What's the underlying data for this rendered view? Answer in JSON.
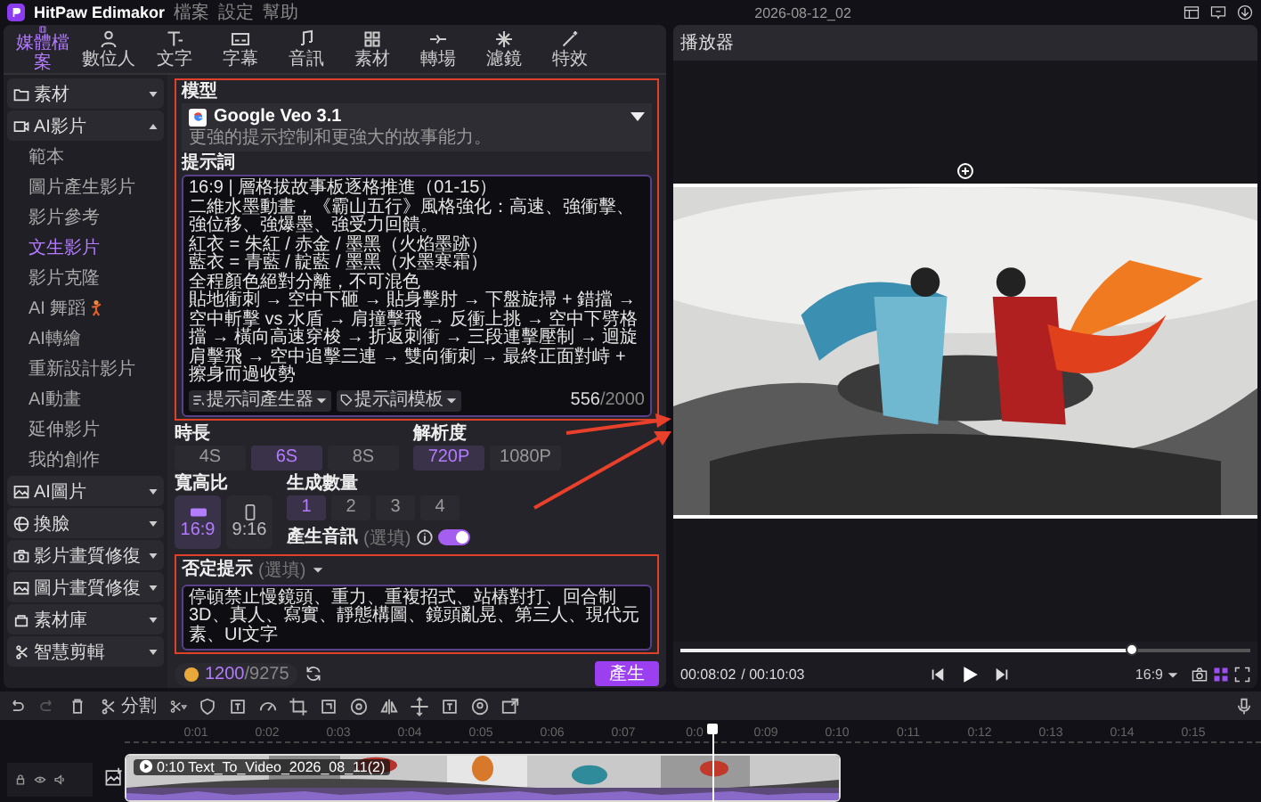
{
  "app": {
    "name": "HitPaw Edimakor",
    "menu": [
      "檔案",
      "設定",
      "幫助"
    ],
    "project": "2026-08-12_02"
  },
  "tabs": [
    {
      "label": "媒體檔案",
      "selected": true
    },
    {
      "label": "數位人",
      "selected": false
    },
    {
      "label": "文字",
      "selected": false
    },
    {
      "label": "字幕",
      "selected": false
    },
    {
      "label": "音訊",
      "selected": false
    },
    {
      "label": "素材",
      "selected": false
    },
    {
      "label": "轉場",
      "selected": false
    },
    {
      "label": "濾鏡",
      "selected": false
    },
    {
      "label": "特效",
      "selected": false
    }
  ],
  "sidebar": {
    "items": [
      {
        "label": "素材",
        "expanded": false
      },
      {
        "label": "AI影片",
        "expanded": true,
        "children": [
          {
            "label": "範本",
            "selected": false
          },
          {
            "label": "圖片產生影片",
            "selected": false
          },
          {
            "label": "影片參考",
            "selected": false
          },
          {
            "label": "文生影片",
            "selected": true
          },
          {
            "label": "影片克隆",
            "selected": false
          },
          {
            "label": "AI 舞蹈",
            "selected": false,
            "kind": "badge"
          },
          {
            "label": "AI轉繪",
            "selected": false
          },
          {
            "label": "重新設計影片",
            "selected": false
          },
          {
            "label": "AI動畫",
            "selected": false
          },
          {
            "label": "延伸影片",
            "selected": false
          },
          {
            "label": "我的創作",
            "selected": false
          }
        ]
      },
      {
        "label": "AI圖片",
        "expanded": false
      },
      {
        "label": "換臉",
        "expanded": false
      },
      {
        "label": "影片畫質修復",
        "expanded": false
      },
      {
        "label": "圖片畫質修復",
        "expanded": false
      },
      {
        "label": "素材庫",
        "expanded": false
      },
      {
        "label": "智慧剪輯",
        "expanded": false
      }
    ]
  },
  "panel": {
    "model": {
      "label": "模型",
      "name": "Google Veo 3.1",
      "description": "更強的提示控制和更強大的故事能力。"
    },
    "prompt": {
      "label": "提示詞",
      "value": [
        "16:9 | 層格拔故事板逐格推進（01-15）",
        "二維水墨動畫，《霸山五行》風格強化：高速、強衝擊、強位移、強爆墨、強受力回饋。",
        "紅衣 = 朱紅 / 赤金 / 墨黑（火焰墨跡）",
        "藍衣 = 青藍 / 靛藍 / 墨黑（水墨寒霜）",
        "全程顏色絕對分離，不可混色",
        "貼地衝刺 → 空中下砸 → 貼身擊肘 → 下盤旋掃 + 錯擋 → 空中斬擊 vs 水盾 → 肩撞擊飛 → 反衝上挑 → 空中下劈格擋 → 橫向高速穿梭 → 折返刺衝 → 三段連擊壓制 → 迴旋肩擊飛 → 空中追擊三連 → 雙向衝刺 → 最終正面對峙 + 擦身而過收勢"
      ],
      "buttons": [
        "提示詞產生器",
        "提示詞模板"
      ],
      "count": "556",
      "limit": "/2000"
    },
    "duration": {
      "label": "時長",
      "options": [
        {
          "label": "4S",
          "selected": false
        },
        {
          "label": "6S",
          "selected": true
        },
        {
          "label": "8S",
          "selected": false
        }
      ]
    },
    "resolution": {
      "label": "解析度",
      "options": [
        {
          "label": "720P",
          "selected": true
        },
        {
          "label": "1080P",
          "selected": false
        }
      ]
    },
    "aspect": {
      "label": "寬高比",
      "options": [
        {
          "label": "16:9",
          "selected": true,
          "kind": "landscape"
        },
        {
          "label": "9:16",
          "selected": false,
          "kind": "portrait"
        }
      ]
    },
    "count": {
      "label": "生成數量",
      "options": [
        {
          "label": "1",
          "selected": true
        },
        {
          "label": "2",
          "selected": false
        },
        {
          "label": "3",
          "selected": false
        },
        {
          "label": "4",
          "selected": false
        }
      ]
    },
    "audio": {
      "label": "產生音訊",
      "hint": "(選填)",
      "on": true
    },
    "negative": {
      "label": "否定提示",
      "hint": "(選填)",
      "value": [
        "停頓禁止慢鏡頭、重力、重複招式、站樁對打、回合制",
        "3D、真人、寫實、靜態構圖、鏡頭亂晃、第三人、現代元素、UI文字"
      ]
    },
    "credits": {
      "used": "1200",
      "total": "/9275"
    },
    "generate": "產生"
  },
  "player": {
    "title": "播放器",
    "current": "00:08:02",
    "total": "/ 00:10:03",
    "level": 0.79,
    "aspect": "16:9"
  },
  "timeline": {
    "split": "分割",
    "ticks": [
      "0:01",
      "0:02",
      "0:03",
      "0:04",
      "0:05",
      "0:06",
      "0:07",
      "0:0",
      "0:09",
      "0:10",
      "0:11",
      "0:12",
      "0:13",
      "0:14",
      "0:15"
    ],
    "clip": "0:10 Text_To_Video_2026_08_11(2)"
  }
}
